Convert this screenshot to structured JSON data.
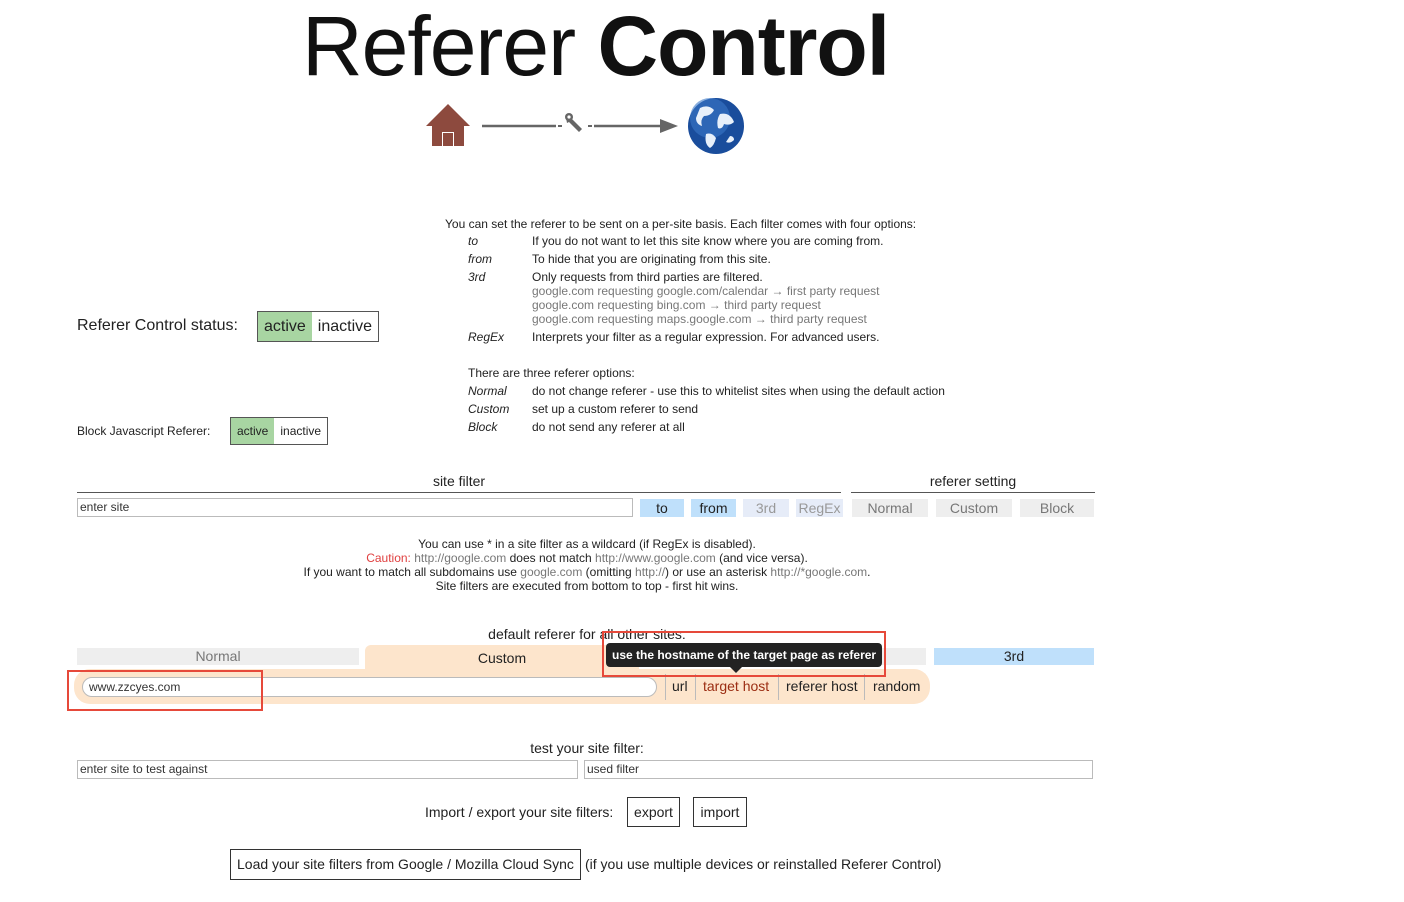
{
  "title": {
    "light": "Referer",
    "bold": "Control"
  },
  "logo": {
    "home": "home-icon",
    "tool": "wrench-icon",
    "globe": "globe-icon"
  },
  "status": {
    "label": "Referer Control status:",
    "active": "active",
    "inactive": "inactive",
    "selected": "active"
  },
  "js_block": {
    "label": "Block Javascript Referer:",
    "active": "active",
    "inactive": "inactive",
    "selected": "active"
  },
  "help": {
    "intro": "You can set the referer to be sent on a per-site basis. Each filter comes with four options:",
    "options": [
      {
        "key": "to",
        "desc": "If you do not want to let this site know where you are coming from."
      },
      {
        "key": "from",
        "desc": "To hide that you are originating from this site."
      },
      {
        "key": "3rd",
        "desc": "Only requests from third parties are filtered."
      },
      {
        "key": "RegEx",
        "desc": "Interprets your filter as a regular expression. For advanced users."
      }
    ],
    "examples": [
      "google.com requesting google.com/calendar → first party request",
      "google.com requesting bing.com → third party request",
      "google.com requesting maps.google.com → third party request"
    ],
    "referer_intro": "There are three referer options:",
    "referer_options": [
      {
        "key": "Normal",
        "desc": "do not change referer - use this to whitelist sites when using the default action"
      },
      {
        "key": "Custom",
        "desc": "set up a custom referer to send"
      },
      {
        "key": "Block",
        "desc": "do not send any referer at all"
      }
    ]
  },
  "filter": {
    "site_filter_label": "site filter",
    "referer_setting_label": "referer setting",
    "site_placeholder": "enter site",
    "buttons": [
      "to",
      "from",
      "3rd",
      "RegEx"
    ],
    "referer_buttons": [
      "Normal",
      "Custom",
      "Block"
    ]
  },
  "wildcard_info": {
    "line1": "You can use * in a site filter as a wildcard (if RegEx is disabled).",
    "caution": "Caution:",
    "l2a": "http://google.com",
    "l2b": " does not match ",
    "l2c": "http://www.google.com",
    "l2d": " (and vice versa).",
    "l3a": "If you want to match all subdomains use ",
    "l3b": "google.com",
    "l3c": " (omitting ",
    "l3d": "http://",
    "l3e": ") or use an asterisk ",
    "l3f": "http://*google.com",
    "l3g": ".",
    "line4": "Site filters are executed from bottom to top - first hit wins."
  },
  "default_referer": {
    "label": "default referer for all other sites:",
    "tabs": [
      "Normal",
      "Custom",
      "3rd"
    ],
    "custom_value": "www.zzcyes.com",
    "options": [
      "url",
      "target host",
      "referer host",
      "random"
    ],
    "selected_option": "target host",
    "tooltip": "use the hostname of the target page as referer"
  },
  "test": {
    "label": "test your site filter:",
    "site_placeholder": "enter site to test against",
    "filter_placeholder": "used filter"
  },
  "import_export": {
    "label": "Import / export your site filters:",
    "export": "export",
    "import": "import"
  },
  "sync": {
    "button": "Load your site filters from Google / Mozilla Cloud Sync",
    "note": "(if you use multiple devices or reinstalled Referer Control)"
  }
}
